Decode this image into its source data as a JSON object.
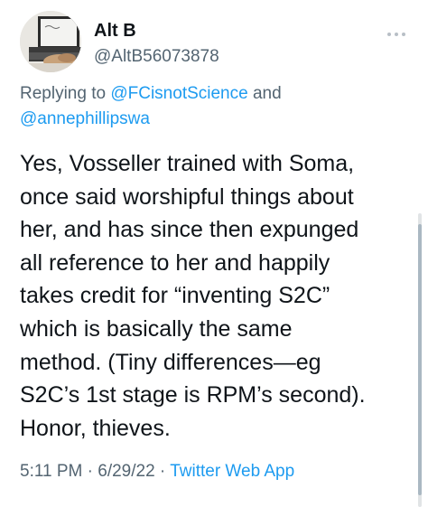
{
  "tweet": {
    "display_name": "Alt B",
    "handle": "@AltB56073878",
    "more_icon": "more-dots-icon",
    "reply": {
      "prefix": "Replying to ",
      "user1": "@FCisnotScience",
      "joiner": " and",
      "user2": "@annephillipswa"
    },
    "body_lines": [
      "Yes, Vosseller trained with Soma,",
      "once said worshipful things about",
      "her, and has since then expunged",
      "all reference to her and happily",
      "takes credit for “inventing S2C”",
      "which is basically the same",
      "method. (Tiny differences—eg",
      "S2C’s 1st stage is RPM’s second).",
      "Honor, thieves."
    ],
    "time": "5:11 PM",
    "sep1": " · ",
    "date": "6/29/22",
    "sep2": " · ",
    "source": "Twitter Web App"
  },
  "colors": {
    "text": "#0f1419",
    "secondary": "#536471",
    "link": "#1d9bf0"
  }
}
